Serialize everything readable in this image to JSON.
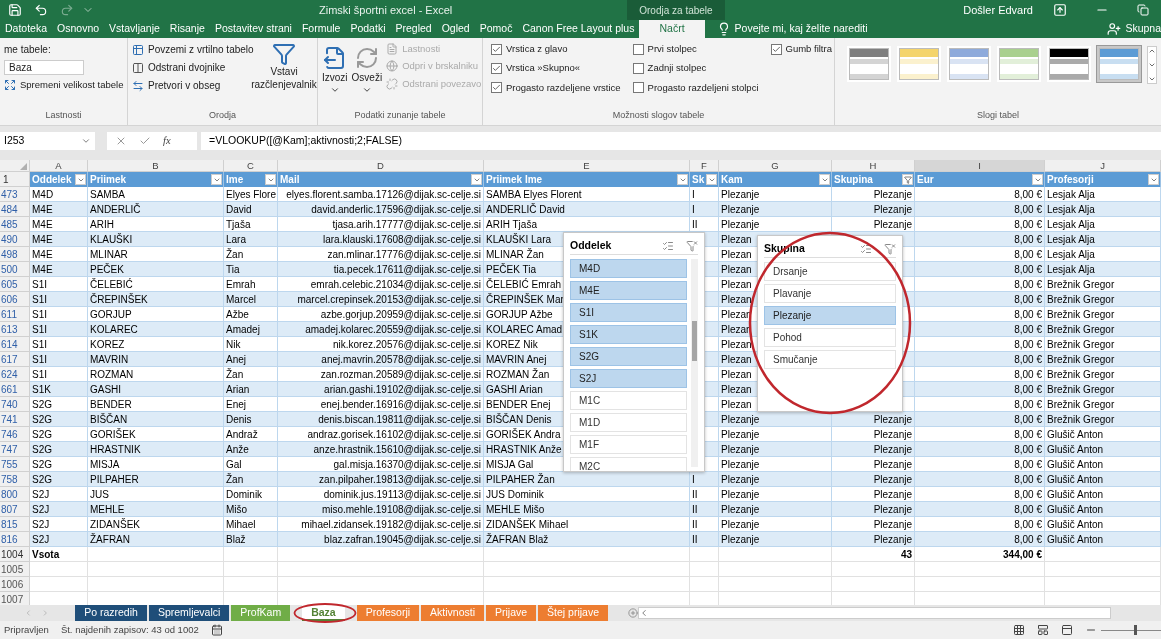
{
  "title_bar": {
    "title": "Zimski športni excel - Excel",
    "context_group": "Orodja za tabele",
    "user": "Došler Edvard"
  },
  "menu_tabs": [
    {
      "label": "Datoteka",
      "selected": false
    },
    {
      "label": "Osnovno",
      "selected": false
    },
    {
      "label": "Vstavljanje",
      "selected": false
    },
    {
      "label": "Risanje",
      "selected": false
    },
    {
      "label": "Postavitev strani",
      "selected": false
    },
    {
      "label": "Formule",
      "selected": false
    },
    {
      "label": "Podatki",
      "selected": false
    },
    {
      "label": "Pregled",
      "selected": false
    },
    {
      "label": "Ogled",
      "selected": false
    },
    {
      "label": "Pomoč",
      "selected": false
    },
    {
      "label": "Canon Free Layout plus",
      "selected": false
    },
    {
      "label": "Načrt",
      "selected": true
    }
  ],
  "tell_me": "Povejte mi, kaj želite narediti",
  "share": "Skupna",
  "ribbon": {
    "lastnosti": {
      "name_label": "me tabele:",
      "name_value": "Baza",
      "resize": "Spremeni velikost tabele",
      "label": "Lastnosti"
    },
    "orodja": {
      "items": [
        "Povzemi z vrtilno tabelo",
        "Odstrani dvojnike",
        "Pretvori v obseg"
      ],
      "slicer": "Vstavi razčlenjevalnik",
      "label": "Orodja"
    },
    "external": {
      "export": "Izvozi",
      "refresh": "Osveži",
      "items": [
        {
          "label": "Lastnosti",
          "disabled": true
        },
        {
          "label": "Odpri v brskalniku",
          "disabled": true
        },
        {
          "label": "Odstrani povezavo",
          "disabled": true
        }
      ],
      "label": "Podatki zunanje tabele"
    },
    "style_options": {
      "columns": [
        [
          {
            "label": "Vrstica z glavo",
            "checked": true
          },
          {
            "label": "Vrstica »Skupno«",
            "checked": true
          },
          {
            "label": "Progasto razdeljene vrstice",
            "checked": true
          }
        ],
        [
          {
            "label": "Prvi stolpec",
            "checked": false
          },
          {
            "label": "Zadnji stolpec",
            "checked": false
          },
          {
            "label": "Progasto razdeljeni stolpci",
            "checked": false
          }
        ],
        [
          {
            "label": "Gumb filtra",
            "checked": true
          }
        ]
      ],
      "label": "Možnosti slogov tabele"
    },
    "styles": {
      "items": [
        {
          "color": "#7f7f7f",
          "selected": false
        },
        {
          "color": "#f4d46b",
          "selected": false
        },
        {
          "color": "#8eaadb",
          "selected": false
        },
        {
          "color": "#a9d08e",
          "selected": false
        },
        {
          "color": "#000000",
          "selected": false
        },
        {
          "color": "#5b9bd5",
          "selected": true
        }
      ],
      "label": "Slogi tabel"
    }
  },
  "name_box": "I253",
  "fx_label": "fx",
  "formula": "=VLOOKUP([@Kam];aktivnosti;2;FALSE)",
  "column_letters": [
    "A",
    "B",
    "C",
    "D",
    "E",
    "F",
    "G",
    "H",
    "I",
    "J"
  ],
  "table": {
    "header_row": "1",
    "headers": [
      {
        "label": "Oddelek",
        "filtered": false
      },
      {
        "label": "Priimek",
        "filtered": false
      },
      {
        "label": "Ime",
        "filtered": false
      },
      {
        "label": "Mail",
        "filtered": false
      },
      {
        "label": "Priimek Ime",
        "filtered": false
      },
      {
        "label": "Sk",
        "filtered": false
      },
      {
        "label": "Kam",
        "filtered": false
      },
      {
        "label": "Skupina",
        "filtered": true
      },
      {
        "label": "Eur",
        "filtered": false
      },
      {
        "label": "Profesorji",
        "filtered": false
      }
    ],
    "rows": [
      {
        "row": "473",
        "kind": "data",
        "oddelek": "M4D",
        "priimek": "SAMBA",
        "ime": "Elyes Flore",
        "mail": "elyes.florent.samba.17126@dijak.sc-celje.si",
        "priimek_ime": "SAMBA Elyes Florent",
        "sk": "I",
        "kam": "Plezanje",
        "skupina": "Plezanje",
        "eur": "8,00 €",
        "profesor": "Lesjak Alja"
      },
      {
        "row": "484",
        "kind": "data",
        "oddelek": "M4E",
        "priimek": "ANDERLIČ",
        "ime": "David",
        "mail": "david.anderlic.17596@dijak.sc-celje.si",
        "priimek_ime": "ANDERLIČ David",
        "sk": "I",
        "kam": "Plezanje",
        "skupina": "Plezanje",
        "eur": "8,00 €",
        "profesor": "Lesjak Alja"
      },
      {
        "row": "485",
        "kind": "data",
        "oddelek": "M4E",
        "priimek": "ARIH",
        "ime": "Tjaša",
        "mail": "tjasa.arih.17777@dijak.sc-celje.si",
        "priimek_ime": "ARIH Tjaša",
        "sk": "II",
        "kam": "Plezanje",
        "skupina": "Plezanje",
        "eur": "8,00 €",
        "profesor": "Lesjak Alja"
      },
      {
        "row": "490",
        "kind": "data",
        "oddelek": "M4E",
        "priimek": "KLAUŠKI",
        "ime": "Lara",
        "mail": "lara.klauski.17608@dijak.sc-celje.si",
        "priimek_ime": "KLAUŠKI Lara",
        "kam": "Plezan",
        "eur": "8,00 €",
        "profesor": "Lesjak Alja"
      },
      {
        "row": "498",
        "kind": "data",
        "oddelek": "M4E",
        "priimek": "MLINAR",
        "ime": "Žan",
        "mail": "zan.mlinar.17776@dijak.sc-celje.si",
        "priimek_ime": "MLINAR Žan",
        "kam": "Plezan",
        "eur": "8,00 €",
        "profesor": "Lesjak Alja"
      },
      {
        "row": "500",
        "kind": "data",
        "oddelek": "M4E",
        "priimek": "PEČEK",
        "ime": "Tia",
        "mail": "tia.pecek.17611@dijak.sc-celje.si",
        "priimek_ime": "PEČEK Tia",
        "kam": "Plezan",
        "eur": "8,00 €",
        "profesor": "Lesjak Alja"
      },
      {
        "row": "605",
        "kind": "data",
        "oddelek": "S1I",
        "priimek": "ČELEBIĆ",
        "ime": "Emrah",
        "mail": "emrah.celebic.21034@dijak.sc-celje.si",
        "priimek_ime": "ČELEBIĆ Emrah",
        "kam": "Plezan",
        "eur": "8,00 €",
        "profesor": "Brežnik Gregor"
      },
      {
        "row": "606",
        "kind": "data",
        "oddelek": "S1I",
        "priimek": "ČREPINŠEK",
        "ime": "Marcel",
        "mail": "marcel.crepinsek.20153@dijak.sc-celje.si",
        "priimek_ime": "ČREPINŠEK Mar",
        "kam": "Plezan",
        "eur": "8,00 €",
        "profesor": "Brežnik Gregor"
      },
      {
        "row": "611",
        "kind": "data",
        "oddelek": "S1I",
        "priimek": "GORJUP",
        "ime": "Ažbe",
        "mail": "azbe.gorjup.20959@dijak.sc-celje.si",
        "priimek_ime": "GORJUP Ažbe",
        "kam": "Plezan",
        "eur": "8,00 €",
        "profesor": "Brežnik Gregor"
      },
      {
        "row": "613",
        "kind": "data",
        "oddelek": "S1I",
        "priimek": "KOLAREC",
        "ime": "Amadej",
        "mail": "amadej.kolarec.20559@dijak.sc-celje.si",
        "priimek_ime": "KOLAREC Amad",
        "kam": "Plezan",
        "eur": "8,00 €",
        "profesor": "Brežnik Gregor"
      },
      {
        "row": "614",
        "kind": "data",
        "oddelek": "S1I",
        "priimek": "KOREZ",
        "ime": "Nik",
        "mail": "nik.korez.20576@dijak.sc-celje.si",
        "priimek_ime": "KOREZ Nik",
        "kam": "Plezan",
        "eur": "8,00 €",
        "profesor": "Brežnik Gregor"
      },
      {
        "row": "617",
        "kind": "data",
        "oddelek": "S1I",
        "priimek": "MAVRIN",
        "ime": "Anej",
        "mail": "anej.mavrin.20578@dijak.sc-celje.si",
        "priimek_ime": "MAVRIN Anej",
        "kam": "Plezan",
        "eur": "8,00 €",
        "profesor": "Brežnik Gregor"
      },
      {
        "row": "624",
        "kind": "data",
        "oddelek": "S1I",
        "priimek": "ROZMAN",
        "ime": "Žan",
        "mail": "zan.rozman.20589@dijak.sc-celje.si",
        "priimek_ime": "ROZMAN Žan",
        "kam": "Plezan",
        "eur": "8,00 €",
        "profesor": "Brežnik Gregor"
      },
      {
        "row": "661",
        "kind": "data",
        "oddelek": "S1K",
        "priimek": "GASHI",
        "ime": "Arian",
        "mail": "arian.gashi.19102@dijak.sc-celje.si",
        "priimek_ime": "GASHI Arian",
        "kam": "Plezan",
        "eur": "8,00 €",
        "profesor": "Brežnik Gregor"
      },
      {
        "row": "740",
        "kind": "data",
        "oddelek": "S2G",
        "priimek": "BENDER",
        "ime": "Enej",
        "mail": "enej.bender.16916@dijak.sc-celje.si",
        "priimek_ime": "BENDER Enej",
        "kam": "Plezan",
        "eur": "8,00 €",
        "profesor": "Brežnik Gregor"
      },
      {
        "row": "741",
        "kind": "data",
        "oddelek": "S2G",
        "priimek": "BIŠČAN",
        "ime": "Denis",
        "mail": "denis.biscan.19811@dijak.sc-celje.si",
        "priimek_ime": "BIŠČAN Denis",
        "kam": "Plezanje",
        "skupina": "Plezanje",
        "eur": "8,00 €",
        "profesor": "Brežnik Gregor"
      },
      {
        "row": "746",
        "kind": "data",
        "oddelek": "S2G",
        "priimek": "GORIŠEK",
        "ime": "Andraž",
        "mail": "andraz.gorisek.16102@dijak.sc-celje.si",
        "priimek_ime": "GORIŠEK Andra",
        "kam": "Plezanje",
        "skupina": "Plezanje",
        "eur": "8,00 €",
        "profesor": "Glušič Anton"
      },
      {
        "row": "747",
        "kind": "data",
        "oddelek": "S2G",
        "priimek": "HRASTNIK",
        "ime": "Anže",
        "mail": "anze.hrastnik.15610@dijak.sc-celje.si",
        "priimek_ime": "HRASTNIK Anže",
        "kam": "Plezanje",
        "skupina": "Plezanje",
        "eur": "8,00 €",
        "profesor": "Glušič Anton"
      },
      {
        "row": "755",
        "kind": "data",
        "oddelek": "S2G",
        "priimek": "MISJA",
        "ime": "Gal",
        "mail": "gal.misja.16370@dijak.sc-celje.si",
        "priimek_ime": "MISJA Gal",
        "kam": "Plezanje",
        "skupina": "Plezanje",
        "eur": "8,00 €",
        "profesor": "Glušič Anton"
      },
      {
        "row": "758",
        "kind": "data",
        "oddelek": "S2G",
        "priimek": "PILPAHER",
        "ime": "Žan",
        "mail": "zan.pilpaher.19813@dijak.sc-celje.si",
        "priimek_ime": "PILPAHER Žan",
        "sk": "I",
        "kam": "Plezanje",
        "skupina": "Plezanje",
        "eur": "8,00 €",
        "profesor": "Glušič Anton"
      },
      {
        "row": "800",
        "kind": "data",
        "oddelek": "S2J",
        "priimek": "JUS",
        "ime": "Dominik",
        "mail": "dominik.jus.19113@dijak.sc-celje.si",
        "priimek_ime": "JUS Dominik",
        "sk": "II",
        "kam": "Plezanje",
        "skupina": "Plezanje",
        "eur": "8,00 €",
        "profesor": "Glušič Anton"
      },
      {
        "row": "807",
        "kind": "data",
        "oddelek": "S2J",
        "priimek": "MEHLE",
        "ime": "Mišo",
        "mail": "miso.mehle.19108@dijak.sc-celje.si",
        "priimek_ime": "MEHLE Mišo",
        "sk": "II",
        "kam": "Plezanje",
        "skupina": "Plezanje",
        "eur": "8,00 €",
        "profesor": "Glušič Anton"
      },
      {
        "row": "815",
        "kind": "data",
        "oddelek": "S2J",
        "priimek": "ZIDANŠEK",
        "ime": "Mihael",
        "mail": "mihael.zidansek.19182@dijak.sc-celje.si",
        "priimek_ime": "ZIDANŠEK Mihael",
        "sk": "II",
        "kam": "Plezanje",
        "skupina": "Plezanje",
        "eur": "8,00 €",
        "profesor": "Glušič Anton"
      },
      {
        "row": "816",
        "kind": "data",
        "oddelek": "S2J",
        "priimek": "ŽAFRAN",
        "ime": "Blaž",
        "mail": "blaz.zafran.19045@dijak.sc-celje.si",
        "priimek_ime": "ŽAFRAN Blaž",
        "sk": "II",
        "kam": "Plezanje",
        "skupina": "Plezanje",
        "eur": "8,00 €",
        "profesor": "Glušič Anton"
      },
      {
        "row": "1004",
        "kind": "total",
        "oddelek": "Vsota",
        "skupina": "43",
        "eur": "344,00 €"
      },
      {
        "row": "1005",
        "kind": "empty"
      },
      {
        "row": "1006",
        "kind": "empty"
      },
      {
        "row": "1007",
        "kind": "empty"
      }
    ]
  },
  "slicers": [
    {
      "title": "Oddelek",
      "items": [
        {
          "label": "M4D",
          "selected": true
        },
        {
          "label": "M4E",
          "selected": true
        },
        {
          "label": "S1I",
          "selected": true
        },
        {
          "label": "S1K",
          "selected": true
        },
        {
          "label": "S2G",
          "selected": true
        },
        {
          "label": "S2J",
          "selected": true
        },
        {
          "label": "M1C",
          "selected": false
        },
        {
          "label": "M1D",
          "selected": false
        },
        {
          "label": "M1F",
          "selected": false
        },
        {
          "label": "M2C",
          "selected": false
        }
      ]
    },
    {
      "title": "Skupina",
      "items": [
        {
          "label": "Drsanje",
          "selected": false
        },
        {
          "label": "Plavanje",
          "selected": false
        },
        {
          "label": "Plezanje",
          "selected": true
        },
        {
          "label": "Pohod",
          "selected": false
        },
        {
          "label": "Smučanje",
          "selected": false
        }
      ]
    }
  ],
  "sheet_tabs": [
    {
      "label": "Po razredih",
      "color": "#1f4e79",
      "selected": false
    },
    {
      "label": "Spremljevalci",
      "color": "#1f4e79",
      "selected": false
    },
    {
      "label": "ProfKam",
      "color": "#70ad47",
      "selected": false
    },
    {
      "label": "Baza",
      "color": "#548235",
      "selected": true
    },
    {
      "label": "Profesorji",
      "color": "#ed7d31",
      "selected": false
    },
    {
      "label": "Aktivnosti",
      "color": "#ed7d31",
      "selected": false
    },
    {
      "label": "Prijave",
      "color": "#ed7d31",
      "selected": false
    },
    {
      "label": "Štej prijave",
      "color": "#ed7d31",
      "selected": false
    }
  ],
  "status_bar": {
    "ready": "Pripravljen",
    "records": "Št. najdenih zapisov: 43 od 1002",
    "zoom_slider": {
      "level": 0.55
    }
  }
}
